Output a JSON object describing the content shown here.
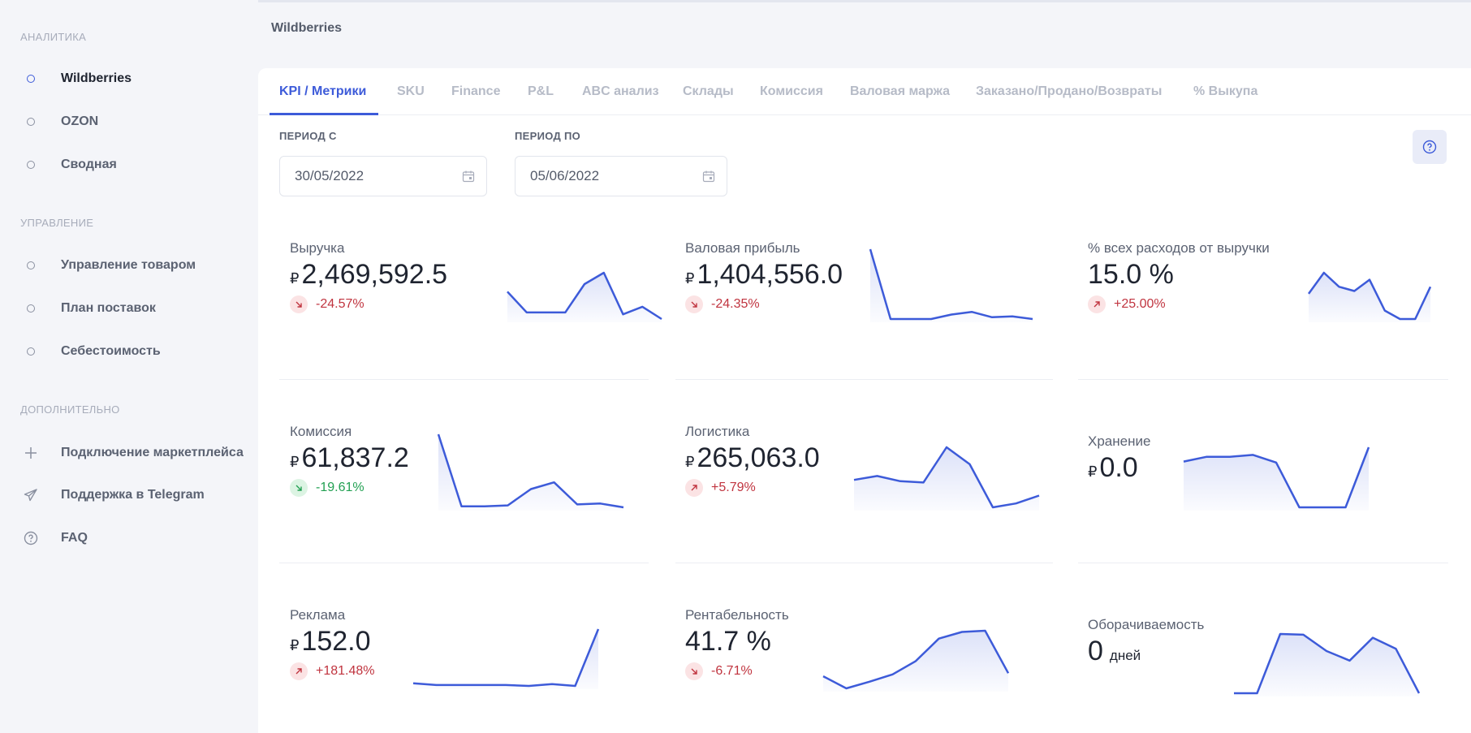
{
  "sidebar": {
    "sections": [
      {
        "title": "АНАЛИТИКА",
        "items": [
          {
            "label": "Wildberries",
            "icon": "circle-icon",
            "active": true
          },
          {
            "label": "OZON",
            "icon": "circle-icon"
          },
          {
            "label": "Сводная",
            "icon": "circle-icon"
          }
        ]
      },
      {
        "title": "УПРАВЛЕНИЕ",
        "items": [
          {
            "label": "Управление товаром",
            "icon": "circle-icon"
          },
          {
            "label": "План поставок",
            "icon": "circle-icon"
          },
          {
            "label": "Себестоимость",
            "icon": "circle-icon"
          }
        ]
      },
      {
        "title": "ДОПОЛНИТЕЛЬНО",
        "items": [
          {
            "label": "Подключение маркетплейса",
            "icon": "plus-icon"
          },
          {
            "label": "Поддержка в Telegram",
            "icon": "telegram-icon"
          },
          {
            "label": "FAQ",
            "icon": "question-circle-icon"
          }
        ]
      }
    ]
  },
  "header": {
    "title": "Wildberries"
  },
  "tabs": [
    "KPI / Метрики",
    "SKU",
    "Finance",
    "P&L",
    "ABC анализ",
    "Склады",
    "Комиссия",
    "Валовая маржа",
    "Заказано/Продано/Возвраты",
    "% Выкупа"
  ],
  "active_tab": 0,
  "period": {
    "from_label": "ПЕРИОД С",
    "from_value": "30/05/2022",
    "to_label": "ПЕРИОД ПО",
    "to_value": "05/06/2022"
  },
  "colors": {
    "accent": "#3d5bd9",
    "negative": "#c0343f",
    "positive": "#22a052"
  },
  "kpis": [
    {
      "name": "Выручка",
      "currency": "₽",
      "value": "2,469,592.5",
      "unit": "",
      "delta": "-24.57%",
      "arrow": "down",
      "tone": "red",
      "spark": [
        42,
        20,
        20,
        20,
        50,
        62,
        18,
        26,
        13
      ]
    },
    {
      "name": "Валовая прибыль",
      "currency": "₽",
      "value": "1,404,556.0",
      "unit": "",
      "delta": "-24.35%",
      "arrow": "down",
      "tone": "red",
      "spark": [
        90,
        12,
        12,
        12,
        17,
        20,
        14,
        15,
        12
      ]
    },
    {
      "name": "% всех расходов от выручки",
      "currency": "",
      "value": "15.0 %",
      "unit": "",
      "delta": "+25.00%",
      "arrow": "up",
      "tone": "red",
      "spark": [
        50,
        65,
        55,
        52,
        60,
        38,
        32,
        32,
        55
      ]
    },
    {
      "name": "Комиссия",
      "currency": "₽",
      "value": "61,837.2",
      "unit": "",
      "delta": "-19.61%",
      "arrow": "down",
      "tone": "green",
      "spark": [
        90,
        15,
        15,
        16,
        33,
        40,
        17,
        18,
        14
      ]
    },
    {
      "name": "Логистика",
      "currency": "₽",
      "value": "265,063.0",
      "unit": "",
      "delta": "+5.79%",
      "arrow": "up",
      "tone": "red",
      "spark": [
        40,
        43,
        39,
        38,
        65,
        52,
        19,
        22,
        28
      ]
    },
    {
      "name": "Хранение",
      "currency": "₽",
      "value": "0.0",
      "unit": "",
      "delta": "",
      "arrow": "",
      "tone": "",
      "spark": [
        48,
        53,
        53,
        55,
        47,
        0,
        0,
        0,
        63
      ]
    },
    {
      "name": "Реклама",
      "currency": "₽",
      "value": "152.0",
      "unit": "",
      "delta": "+181.48%",
      "arrow": "up",
      "tone": "red",
      "spark": [
        2,
        0,
        0,
        0,
        0,
        -1,
        1,
        -1,
        62
      ]
    },
    {
      "name": "Рентабельность",
      "currency": "",
      "value": "41.7 %",
      "unit": "",
      "delta": "-6.71%",
      "arrow": "down",
      "tone": "red",
      "spark": [
        40,
        38,
        39.1,
        40.3,
        42.5,
        46.2,
        47.3,
        47.5,
        40.5
      ]
    },
    {
      "name": "Оборачиваемость",
      "currency": "",
      "value": "0",
      "unit": "дней",
      "delta": "",
      "arrow": "",
      "tone": "",
      "spark": [
        0,
        0,
        80,
        79,
        57,
        44,
        75,
        60,
        0
      ]
    }
  ]
}
